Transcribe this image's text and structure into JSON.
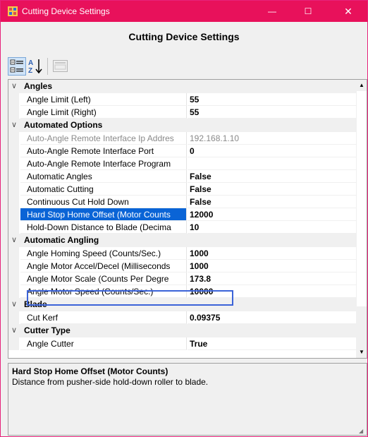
{
  "window": {
    "title": "Cutting Device Settings",
    "accent_color": "#e8115b",
    "controls": {
      "minimize": "—",
      "maximize": "☐",
      "close": "✕"
    }
  },
  "heading": "Cutting Device Settings",
  "toolbar": {
    "buttons": [
      {
        "icon": "categorized-view-icon"
      },
      {
        "icon": "alphabetical-sort-icon"
      },
      {
        "icon": "property-pages-icon"
      }
    ]
  },
  "categories": [
    {
      "name": "Angles",
      "props": [
        {
          "name": "Angle Limit (Left)",
          "value": "55"
        },
        {
          "name": "Angle Limit (Right)",
          "value": "55"
        }
      ]
    },
    {
      "name": "Automated Options",
      "props": [
        {
          "name": "Auto-Angle Remote Interface Ip Addres",
          "value": "192.168.1.10"
        },
        {
          "name": "Auto-Angle Remote Interface Port",
          "value": "0"
        },
        {
          "name": "Auto-Angle Remote Interface Program",
          "value": ""
        },
        {
          "name": "Automatic Angles",
          "value": "False"
        },
        {
          "name": "Automatic Cutting",
          "value": "False"
        },
        {
          "name": "Continuous Cut Hold Down",
          "value": "False"
        },
        {
          "name": "Hard Stop Home Offset (Motor Counts",
          "value": "12000"
        },
        {
          "name": "Hold-Down Distance to Blade (Decima",
          "value": "10"
        }
      ]
    },
    {
      "name": "Automatic Angling",
      "props": [
        {
          "name": "Angle Homing Speed (Counts/Sec.)",
          "value": "1000"
        },
        {
          "name": "Angle Motor Accel/Decel (Milliseconds",
          "value": "1000"
        },
        {
          "name": "Angle Motor Scale (Counts Per Degre",
          "value": "173.8"
        },
        {
          "name": "Angle Motor Speed (Counts/Sec.)",
          "value": "10000"
        }
      ]
    },
    {
      "name": "Blade",
      "props": [
        {
          "name": "Cut Kerf",
          "value": "0.09375"
        }
      ]
    },
    {
      "name": "Cutter Type",
      "props": [
        {
          "name": "Angle Cutter",
          "value": "True"
        }
      ]
    }
  ],
  "help": {
    "title": "Hard Stop Home Offset (Motor Counts)",
    "description": "Distance from pusher-side hold-down roller to blade."
  }
}
